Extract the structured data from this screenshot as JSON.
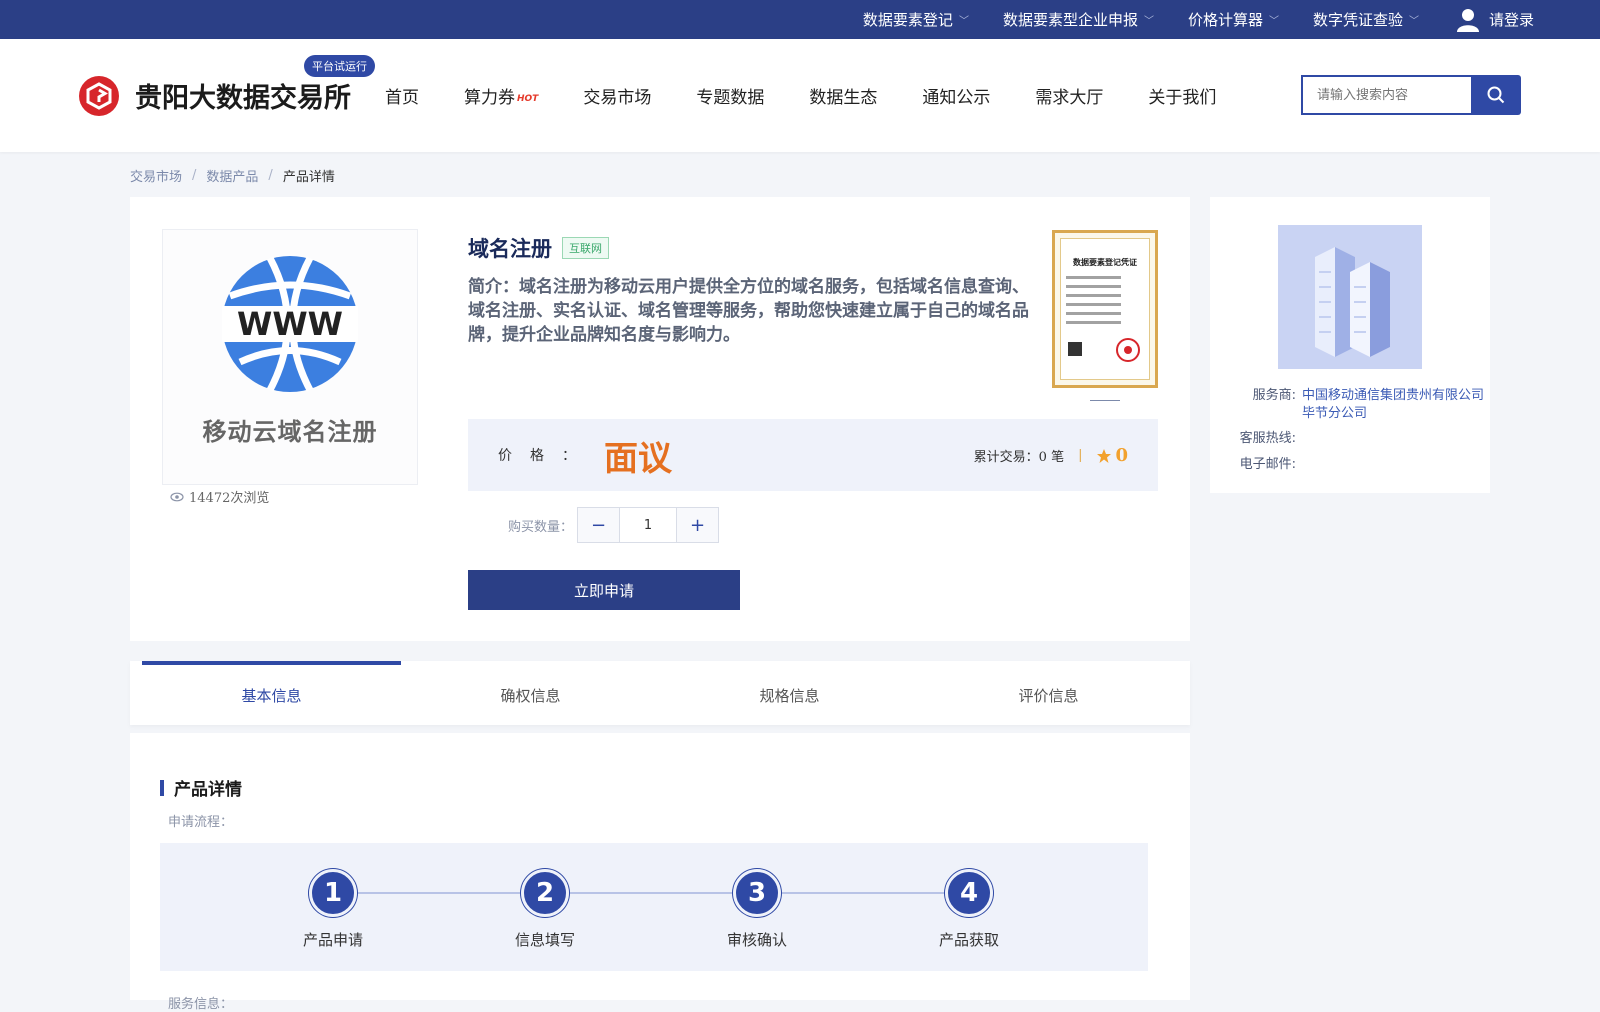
{
  "topbar": {
    "items": [
      {
        "label": "数据要素登记"
      },
      {
        "label": "数据要素型企业申报"
      },
      {
        "label": "价格计算器"
      },
      {
        "label": "数字凭证查验"
      }
    ],
    "login": "请登录"
  },
  "header": {
    "brand": "贵阳大数据交易所",
    "trial_badge": "平台试运行",
    "nav": [
      "首页",
      "算力券",
      "交易市场",
      "专题数据",
      "数据生态",
      "通知公示",
      "需求大厅",
      "关于我们"
    ],
    "hot_label": "HOT",
    "search_placeholder": "请输入搜索内容"
  },
  "breadcrumb": [
    "交易市场",
    "数据产品",
    "产品详情"
  ],
  "product": {
    "image_caption": "移动云域名注册",
    "image_text": "WWW",
    "views": "14472次浏览",
    "title": "域名注册",
    "tag": "互联网",
    "desc": "简介：域名注册为移动云用户提供全方位的域名服务，包括域名信息查询、域名注册、实名认证、域名管理等服务，帮助您快速建立属于自己的域名品牌，提升企业品牌知名度与影响力。",
    "cert_title": "数据要素登记凭证",
    "price_label": "价格：",
    "price": "面议",
    "trades_label": "累计交易：",
    "trades": "0 笔",
    "rating": "0",
    "qty_label": "购买数量：",
    "qty": "1",
    "apply_button": "立即申请"
  },
  "provider": {
    "service_label": "服务商:",
    "service_value": "中国移动通信集团贵州有限公司毕节分公司",
    "hotline_label": "客服热线:",
    "email_label": "电子邮件:"
  },
  "tabs": [
    "基本信息",
    "确权信息",
    "规格信息",
    "评价信息"
  ],
  "detail": {
    "section_title": "产品详情",
    "flow_label": "申请流程：",
    "steps": [
      {
        "num": "1",
        "label": "产品申请"
      },
      {
        "num": "2",
        "label": "信息填写"
      },
      {
        "num": "3",
        "label": "审核确认"
      },
      {
        "num": "4",
        "label": "产品获取"
      }
    ],
    "service_info_label": "服务信息："
  },
  "colors": {
    "primary": "#2b3f86",
    "accent": "#2f49a5",
    "price": "#e57020",
    "rating": "#f2a12d"
  }
}
